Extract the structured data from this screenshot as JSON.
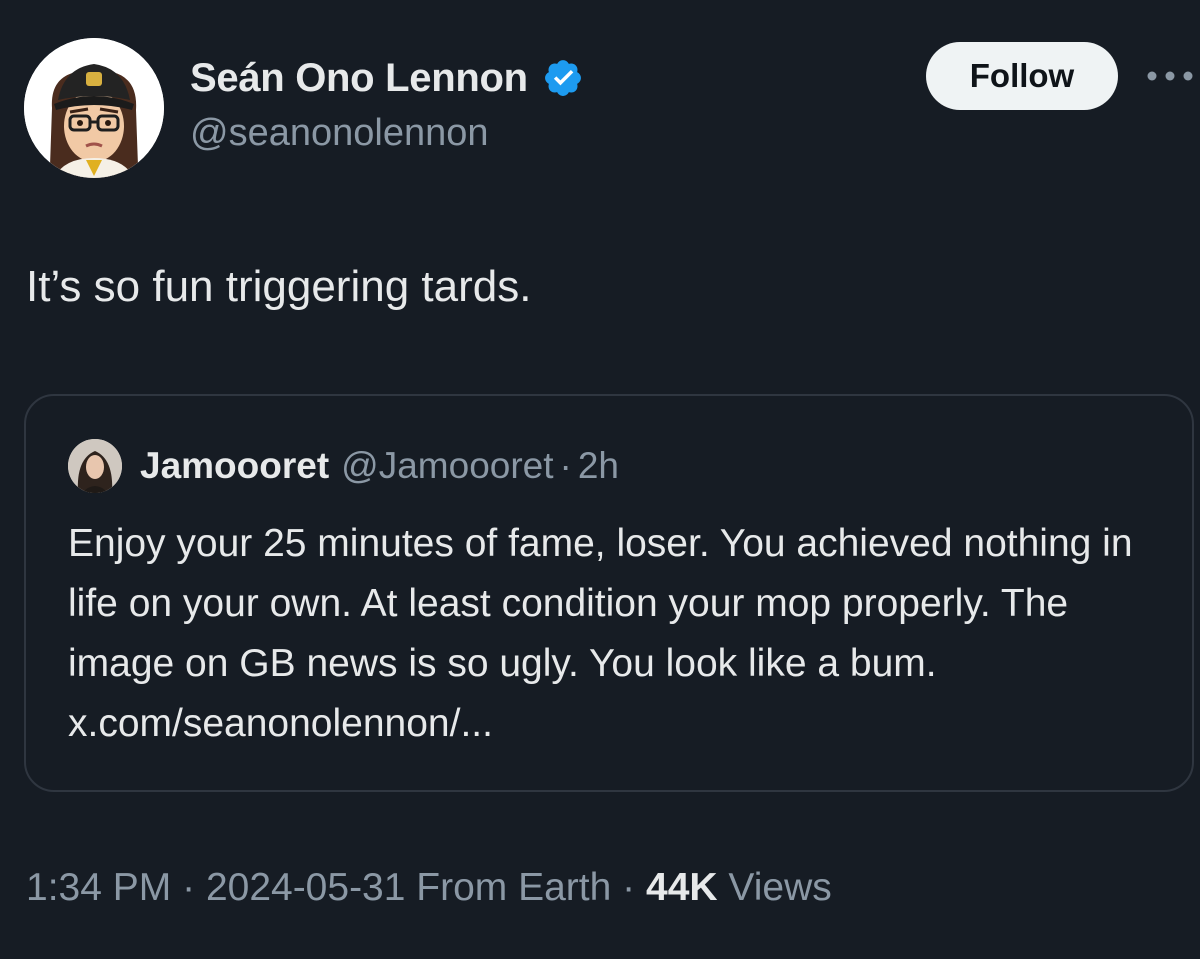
{
  "author": {
    "display_name": "Seán Ono Lennon",
    "handle": "@seanonolennon",
    "verified_icon": "verified-badge-icon",
    "avatar": "avatar"
  },
  "actions": {
    "follow_label": "Follow",
    "more_icon": "more-icon"
  },
  "tweet": {
    "text": "It’s so fun triggering tards."
  },
  "quoted_tweet": {
    "name": "Jamoooret",
    "handle": "@Jamoooret",
    "separator": "·",
    "time": "2h",
    "text": "Enjoy your 25 minutes of fame, loser. You achieved nothing in life on your own. At least condition your mop properly. The image on GB news is so ugly. You look like a bum. x.com/seanonolennon/..."
  },
  "meta": {
    "time": "1:34 PM",
    "sep1": "·",
    "date": "2024-05-31",
    "source": "From Earth",
    "sep2": "·",
    "views_count": "44K",
    "views_label": "Views"
  },
  "colors": {
    "background": "#161c24",
    "text_primary": "#e7e9ea",
    "text_secondary": "#8b98a5",
    "verified_blue": "#1d9bf0",
    "follow_bg": "#eff3f4",
    "border": "#2f3640"
  }
}
